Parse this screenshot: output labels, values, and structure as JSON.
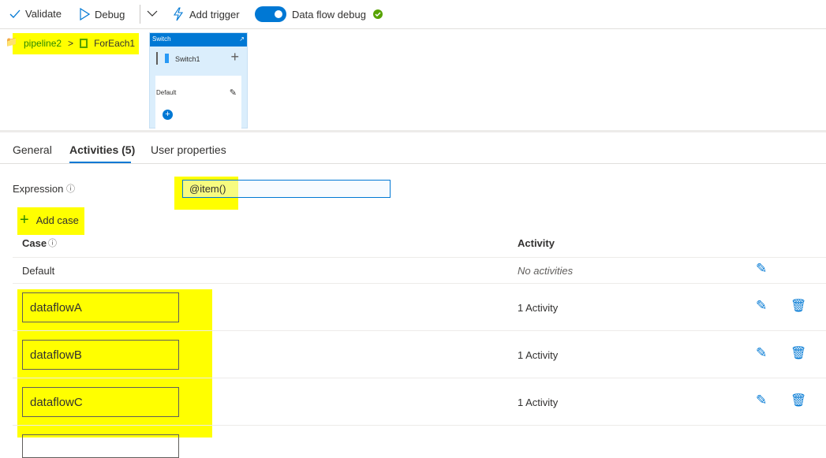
{
  "toolbar": {
    "validate": "Validate",
    "debug": "Debug",
    "add_trigger": "Add trigger",
    "data_flow_debug": "Data flow debug",
    "data_flow_debug_on": true,
    "debug_status": "check-circle-icon"
  },
  "breadcrumb": {
    "items": [
      "pipeline2",
      "ForEach1"
    ],
    "separator": ">"
  },
  "canvas": {
    "header": "Switch",
    "activity_name": "Switch1",
    "case_label": "Default"
  },
  "tabs": [
    {
      "label": "General"
    },
    {
      "label": "Activities (5)",
      "active": true
    },
    {
      "label": "User properties"
    }
  ],
  "expression": {
    "label": "Expression",
    "value": "@item()"
  },
  "add_case": "Add case",
  "table": {
    "headers": {
      "case": "Case",
      "activity": "Activity"
    },
    "default_row": {
      "case": "Default",
      "activity": "No activities"
    },
    "rows": [
      {
        "case": "dataflowA",
        "activity": "1 Activity"
      },
      {
        "case": "dataflowB",
        "activity": "1 Activity"
      },
      {
        "case": "dataflowC",
        "activity": "1 Activity"
      }
    ]
  },
  "colors": {
    "accent": "#0078d4",
    "highlight": "#ffff00",
    "success": "#57a300"
  }
}
